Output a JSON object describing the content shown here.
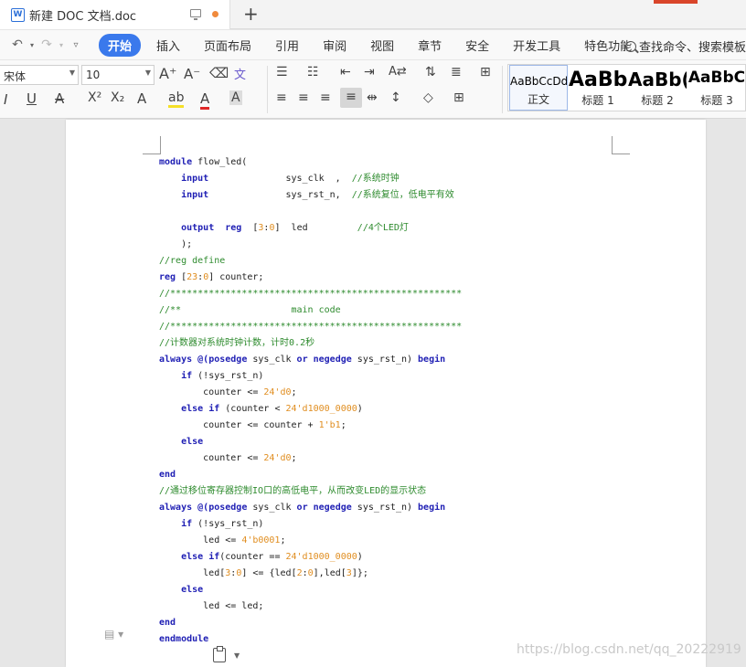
{
  "tab": {
    "icon_letter": "W",
    "title": "新建 DOC 文档.doc",
    "new_tab": "+"
  },
  "menu": {
    "items": [
      "开始",
      "插入",
      "页面布局",
      "引用",
      "审阅",
      "视图",
      "章节",
      "安全",
      "开发工具",
      "特色功能"
    ],
    "search": "查找命令、搜索模板"
  },
  "ribbon": {
    "font_name": "宋体",
    "font_size": "10",
    "styles": [
      {
        "sample": "AaBbCcDd",
        "name": "正文"
      },
      {
        "sample": "AaBb",
        "name": "标题 1"
      },
      {
        "sample": "AaBb(",
        "name": "标题 2"
      },
      {
        "sample": "AaBbC",
        "name": "标题 3"
      }
    ]
  },
  "code_lines": [
    [
      [
        "kw",
        "module"
      ],
      [
        "t",
        " flow_led("
      ]
    ],
    [
      [
        "t",
        "    "
      ],
      [
        "kw",
        "input"
      ],
      [
        "t",
        "              sys_clk  ,  "
      ],
      [
        "cm",
        "//系统时钟"
      ]
    ],
    [
      [
        "t",
        "    "
      ],
      [
        "kw",
        "input"
      ],
      [
        "t",
        "              sys_rst_n,  "
      ],
      [
        "cm",
        "//系统复位，低电平有效"
      ]
    ],
    [],
    [
      [
        "t",
        "    "
      ],
      [
        "kw",
        "output"
      ],
      [
        "t",
        "  "
      ],
      [
        "kw",
        "reg"
      ],
      [
        "t",
        "  ["
      ],
      [
        "nm",
        "3"
      ],
      [
        "t",
        ":"
      ],
      [
        "nm",
        "0"
      ],
      [
        "t",
        "]  led         "
      ],
      [
        "cm",
        "//4个LED灯"
      ]
    ],
    [
      [
        "t",
        "    );"
      ]
    ],
    [
      [
        "cm",
        "//reg define"
      ]
    ],
    [
      [
        "kw",
        "reg"
      ],
      [
        "t",
        " ["
      ],
      [
        "nm",
        "23"
      ],
      [
        "t",
        ":"
      ],
      [
        "nm",
        "0"
      ],
      [
        "t",
        "] counter;"
      ]
    ],
    [
      [
        "cm",
        "//*****************************************************"
      ]
    ],
    [
      [
        "cm",
        "//**                    main code"
      ]
    ],
    [
      [
        "cm",
        "//*****************************************************"
      ]
    ],
    [
      [
        "cm",
        "//计数器对系统时钟计数，计时0.2秒"
      ]
    ],
    [
      [
        "kw",
        "always"
      ],
      [
        "t",
        " "
      ],
      [
        "op",
        "@("
      ],
      [
        "kw",
        "posedge"
      ],
      [
        "t",
        " sys_clk "
      ],
      [
        "kw",
        "or"
      ],
      [
        "t",
        " "
      ],
      [
        "kw",
        "negedge"
      ],
      [
        "t",
        " sys_rst_n) "
      ],
      [
        "kw",
        "begin"
      ]
    ],
    [
      [
        "t",
        "    "
      ],
      [
        "kw",
        "if"
      ],
      [
        "t",
        " (!sys_rst_n)"
      ]
    ],
    [
      [
        "t",
        "        counter <= "
      ],
      [
        "nm",
        "24'd0"
      ],
      [
        "t",
        ";"
      ]
    ],
    [
      [
        "t",
        "    "
      ],
      [
        "kw",
        "else if"
      ],
      [
        "t",
        " (counter < "
      ],
      [
        "nm",
        "24'd1000_0000"
      ],
      [
        "t",
        ")"
      ]
    ],
    [
      [
        "t",
        "        counter <= counter + "
      ],
      [
        "nm",
        "1'b1"
      ],
      [
        "t",
        ";"
      ]
    ],
    [
      [
        "t",
        "    "
      ],
      [
        "kw",
        "else"
      ]
    ],
    [
      [
        "t",
        "        counter <= "
      ],
      [
        "nm",
        "24'd0"
      ],
      [
        "t",
        ";"
      ]
    ],
    [
      [
        "kw",
        "end"
      ]
    ],
    [
      [
        "cm",
        "//通过移位寄存器控制IO口的高低电平，从而改变LED的显示状态"
      ]
    ],
    [
      [
        "kw",
        "always"
      ],
      [
        "t",
        " "
      ],
      [
        "op",
        "@("
      ],
      [
        "kw",
        "posedge"
      ],
      [
        "t",
        " sys_clk "
      ],
      [
        "kw",
        "or"
      ],
      [
        "t",
        " "
      ],
      [
        "kw",
        "negedge"
      ],
      [
        "t",
        " sys_rst_n) "
      ],
      [
        "kw",
        "begin"
      ]
    ],
    [
      [
        "t",
        "    "
      ],
      [
        "kw",
        "if"
      ],
      [
        "t",
        " (!sys_rst_n)"
      ]
    ],
    [
      [
        "t",
        "        led <= "
      ],
      [
        "nm",
        "4'b0001"
      ],
      [
        "t",
        ";"
      ]
    ],
    [
      [
        "t",
        "    "
      ],
      [
        "kw",
        "else if"
      ],
      [
        "t",
        "(counter == "
      ],
      [
        "nm",
        "24'd1000_0000"
      ],
      [
        "t",
        ")"
      ]
    ],
    [
      [
        "t",
        "        led["
      ],
      [
        "nm",
        "3"
      ],
      [
        "t",
        ":"
      ],
      [
        "nm",
        "0"
      ],
      [
        "t",
        "] <= {led["
      ],
      [
        "nm",
        "2"
      ],
      [
        "t",
        ":"
      ],
      [
        "nm",
        "0"
      ],
      [
        "t",
        "],led["
      ],
      [
        "nm",
        "3"
      ],
      [
        "t",
        "]};"
      ]
    ],
    [
      [
        "t",
        "    "
      ],
      [
        "kw",
        "else"
      ]
    ],
    [
      [
        "t",
        "        led <= led;"
      ]
    ],
    [
      [
        "kw",
        "end"
      ]
    ],
    [
      [
        "kw",
        "endmodule"
      ]
    ]
  ],
  "watermark": "https://blog.csdn.net/qq_20222919"
}
